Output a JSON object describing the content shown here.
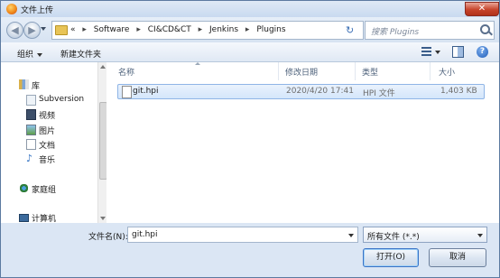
{
  "window": {
    "title": "文件上传",
    "close_glyph": "✕"
  },
  "nav": {
    "back_glyph": "◀",
    "forward_glyph": "▶",
    "breadcrumb_prefix": "«",
    "breadcrumbs": [
      "Software",
      "CI&CD&CT",
      "Jenkins",
      "Plugins"
    ],
    "separator": "▸",
    "refresh_glyph": "↻",
    "search_placeholder": "搜索 Plugins"
  },
  "toolbar": {
    "organize_label": "组织",
    "new_folder_label": "新建文件夹",
    "help_glyph": "?"
  },
  "sidebar": {
    "items": [
      {
        "label": "库",
        "icon": "library-icon"
      },
      {
        "label": "Subversion",
        "icon": "subversion-icon"
      },
      {
        "label": "视频",
        "icon": "videos-icon"
      },
      {
        "label": "图片",
        "icon": "pictures-icon"
      },
      {
        "label": "文档",
        "icon": "documents-icon"
      },
      {
        "label": "音乐",
        "icon": "music-icon"
      },
      {
        "label": "家庭组",
        "icon": "homegroup-icon"
      },
      {
        "label": "计算机",
        "icon": "computer-icon"
      }
    ]
  },
  "file_list": {
    "columns": [
      "名称",
      "修改日期",
      "类型",
      "大小"
    ],
    "rows": [
      {
        "name": "git.hpi",
        "modified": "2020/4/20 17:41",
        "type": "HPI 文件",
        "size": "1,403 KB"
      }
    ]
  },
  "footer": {
    "filename_label": "文件名(N):",
    "filename_value": "git.hpi",
    "filetype_value": "所有文件 (*.*)",
    "open_label": "打开(O)",
    "cancel_label": "取消"
  },
  "colors": {
    "selection": "#d4e6fb",
    "chrome": "#dbe6f4",
    "close": "#c7442c"
  }
}
